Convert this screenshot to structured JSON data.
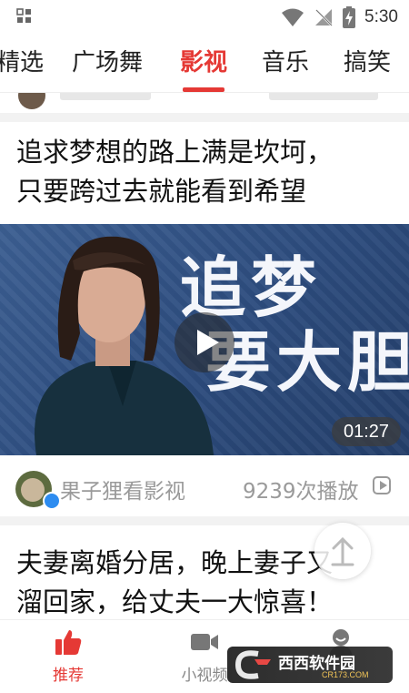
{
  "status_bar": {
    "time": "5:30"
  },
  "tabs": [
    {
      "label": "精选"
    },
    {
      "label": "广场舞"
    },
    {
      "label": "影视",
      "active": true
    },
    {
      "label": "音乐"
    },
    {
      "label": "搞笑"
    }
  ],
  "colors": {
    "accent": "#e53935",
    "meta_text": "#9a9a9a",
    "separator": "#f2f2f2"
  },
  "feed": {
    "item1": {
      "title_lines": [
        "追求梦想的路上满是坎坷，",
        "只要跨过去就能看到希望"
      ],
      "thumbnail_text": [
        "追梦",
        "要大胆"
      ],
      "duration": "01:27",
      "author": "果子狸看影视",
      "plays": "9239次播放"
    },
    "item2": {
      "title_lines": [
        "夫妻离婚分居，晚上妻子又",
        "溜回家，给丈夫一大惊喜！"
      ]
    }
  },
  "bottom_nav": [
    {
      "label": "推荐",
      "icon": "thumbs-up-icon",
      "active": true
    },
    {
      "label": "小视频",
      "icon": "video-camera-icon"
    },
    {
      "label": "",
      "icon": "profile-icon"
    }
  ],
  "watermark": {
    "text": "西西软件园",
    "sub": "CR173.COM"
  }
}
